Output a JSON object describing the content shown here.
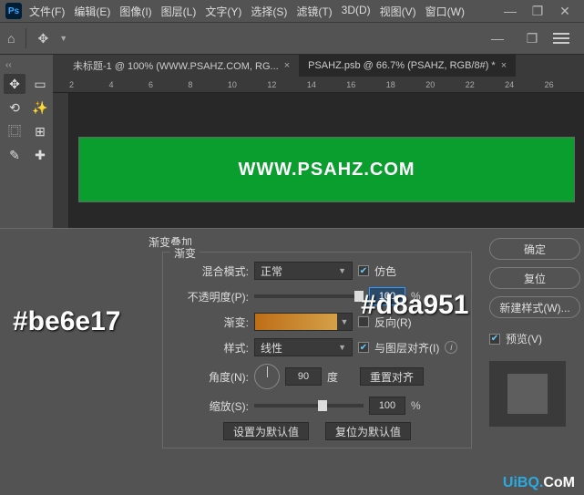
{
  "menubar": {
    "items": [
      "文件(F)",
      "编辑(E)",
      "图像(I)",
      "图层(L)",
      "文字(Y)",
      "选择(S)",
      "滤镜(T)",
      "3D(D)",
      "视图(V)",
      "窗口(W)"
    ]
  },
  "window_controls": {
    "min": "—",
    "max": "❐",
    "close": "✕"
  },
  "tabs": [
    {
      "label": "未标题-1 @ 100% (WWW.PSAHZ.COM, RG...",
      "close": "×"
    },
    {
      "label": "PSAHZ.psb @ 66.7% (PSAHZ, RGB/8#) *",
      "close": "×"
    }
  ],
  "ruler_marks": [
    "2",
    "4",
    "6",
    "8",
    "10",
    "12",
    "14",
    "16",
    "18",
    "20",
    "22",
    "24",
    "26"
  ],
  "canvas_text": "WWW.PSAHZ.COM",
  "dialog": {
    "title": "渐变叠加",
    "legend": "渐变",
    "blend_label": "混合模式:",
    "blend_value": "正常",
    "dither_label": "仿色",
    "opacity_label": "不透明度(P):",
    "opacity_value": "100",
    "pct": "%",
    "gradient_label": "渐变:",
    "reverse_label": "反向(R)",
    "style_label": "样式:",
    "style_value": "线性",
    "align_label": "与图层对齐(I)",
    "angle_label": "角度(N):",
    "angle_value": "90",
    "degree": "度",
    "reset_align": "重置对齐",
    "scale_label": "缩放(S):",
    "scale_value": "100",
    "set_default": "设置为默认值",
    "reset_default": "复位为默认值"
  },
  "buttons": {
    "ok": "确定",
    "cancel": "复位",
    "new_style": "新建样式(W)...",
    "preview": "预览(V)"
  },
  "annotations": {
    "color1": "#be6e17",
    "color2": "#d8a951"
  },
  "watermark": {
    "a": "UiBQ.",
    "b": "CoM"
  }
}
